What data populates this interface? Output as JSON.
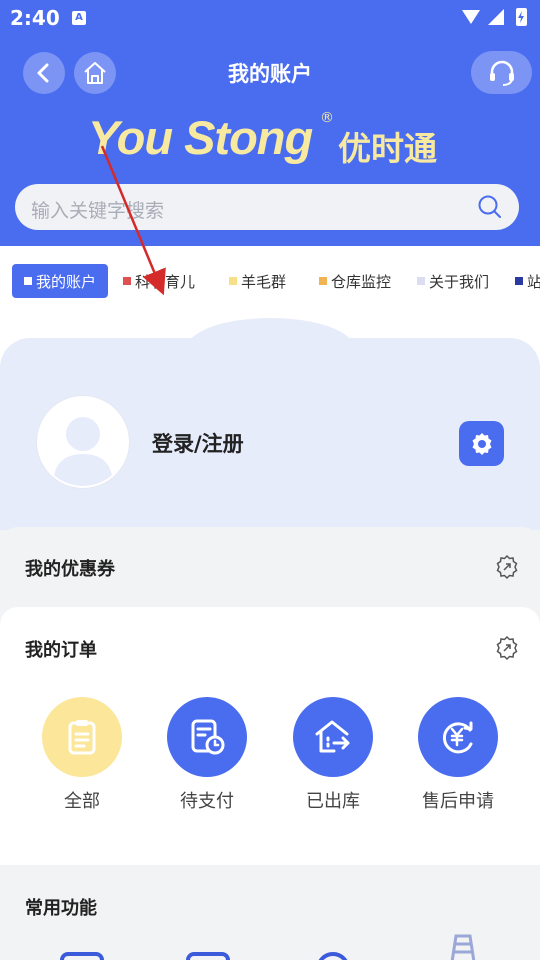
{
  "status": {
    "time": "2:40",
    "app_badge": "A"
  },
  "header": {
    "title": "我的账户"
  },
  "logo": {
    "text_en": "You Stong",
    "reg_mark": "®",
    "text_cn": "优时通"
  },
  "search": {
    "placeholder": "输入关键字搜索"
  },
  "tabs": [
    {
      "label": "我的账户",
      "color": "#ffffff",
      "active": true
    },
    {
      "label": "科学育儿",
      "color": "#e05050"
    },
    {
      "label": "羊毛群",
      "color": "#f7e08a"
    },
    {
      "label": "仓库监控",
      "color": "#f0b552"
    },
    {
      "label": "关于我们",
      "color": "#dcdcf2"
    },
    {
      "label": "站",
      "color": "#2a3aa0"
    }
  ],
  "profile": {
    "login_label": "登录/注册"
  },
  "coupons": {
    "title": "我的优惠券"
  },
  "orders": {
    "title": "我的订单",
    "items": [
      {
        "label": "全部",
        "icon": "clipboard-icon",
        "color": "#fbe69a"
      },
      {
        "label": "待支付",
        "icon": "pending-payment-icon",
        "color": "#4a6df0"
      },
      {
        "label": "已出库",
        "icon": "shipped-icon",
        "color": "#4a6df0"
      },
      {
        "label": "售后申请",
        "icon": "refund-icon",
        "color": "#4a6df0"
      }
    ]
  },
  "common": {
    "title": "常用功能"
  },
  "colors": {
    "primary": "#4a6df0",
    "logo": "#f8e9a0",
    "annotation_arrow": "#d42a2a"
  }
}
